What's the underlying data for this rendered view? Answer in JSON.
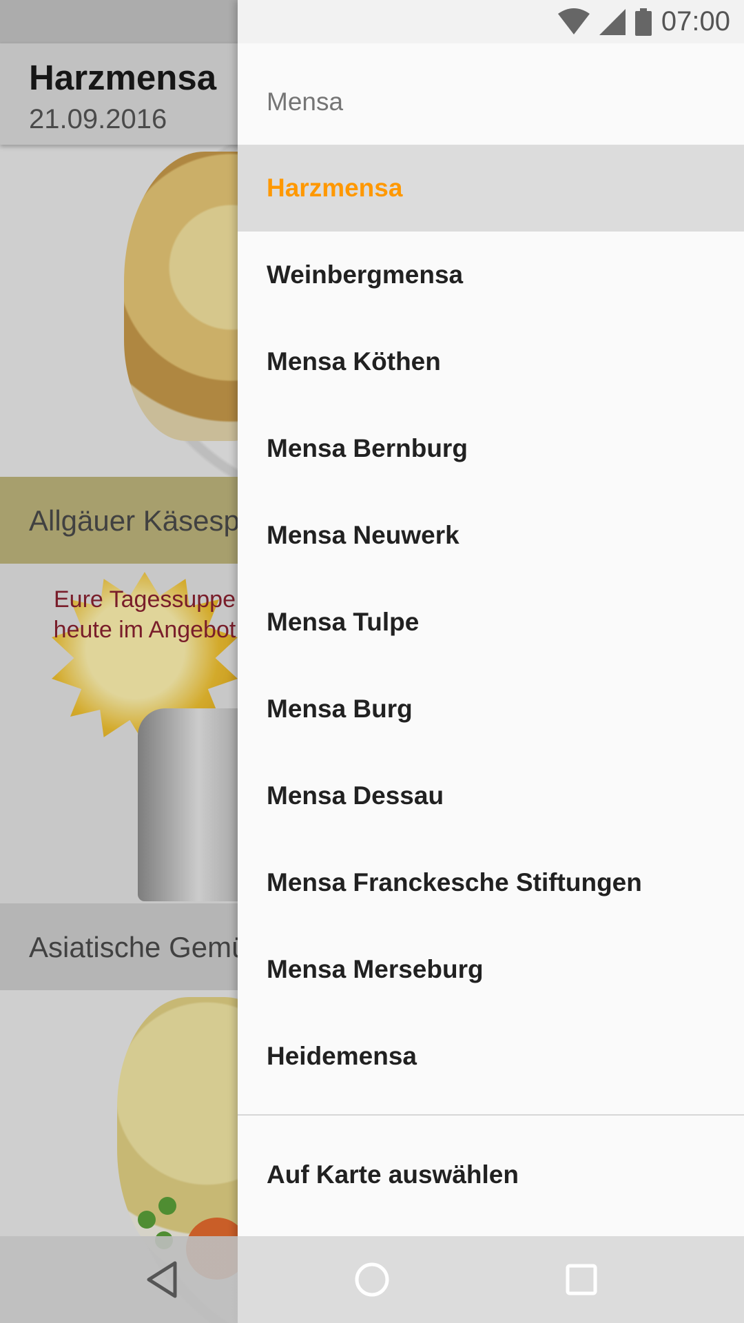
{
  "status_bar": {
    "time": "07:00",
    "icons": [
      "wifi-icon",
      "signal-icon",
      "battery-icon"
    ]
  },
  "background_app": {
    "title": "Harzmensa",
    "date": "21.09.2016",
    "meals": [
      {
        "name": "Allgäuer Käsesp"
      },
      {
        "name": "Asiatische Gemü"
      }
    ],
    "promo_badge": {
      "text": "Eure Tagessuppe heute im Angebot"
    }
  },
  "drawer": {
    "header": "Mensa",
    "items": [
      {
        "label": "Harzmensa",
        "selected": true
      },
      {
        "label": "Weinbergmensa",
        "selected": false
      },
      {
        "label": "Mensa Köthen",
        "selected": false
      },
      {
        "label": "Mensa Bernburg",
        "selected": false
      },
      {
        "label": "Mensa Neuwerk",
        "selected": false
      },
      {
        "label": "Mensa Tulpe",
        "selected": false
      },
      {
        "label": "Mensa Burg",
        "selected": false
      },
      {
        "label": "Mensa Dessau",
        "selected": false
      },
      {
        "label": "Mensa Franckesche Stiftungen",
        "selected": false
      },
      {
        "label": "Mensa Merseburg",
        "selected": false
      },
      {
        "label": "Heidemensa",
        "selected": false
      }
    ],
    "map_action": "Auf Karte auswählen"
  },
  "nav_bar": {
    "buttons": [
      "back-icon",
      "home-icon",
      "recents-icon"
    ]
  },
  "colors": {
    "accent": "#ff9800",
    "selected_background": "#dcdcdc",
    "drawer_background": "#fafafa"
  }
}
